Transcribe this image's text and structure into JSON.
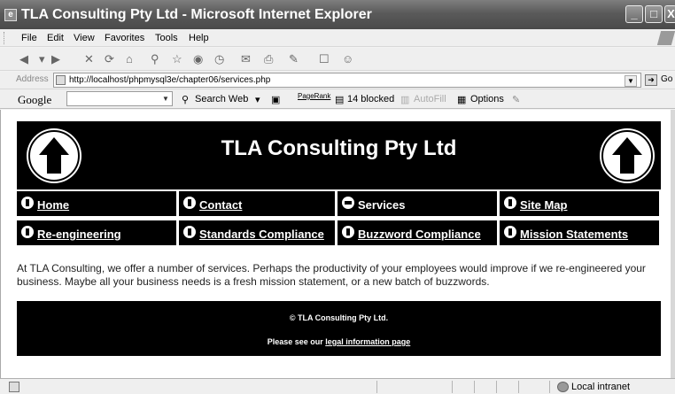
{
  "window": {
    "title": "TLA Consulting Pty Ltd - Microsoft Internet Explorer",
    "app_icon": "ie-page-icon",
    "min_symbol": "_",
    "max_symbol": "□",
    "close_symbol": "X"
  },
  "menu": [
    "File",
    "Edit",
    "View",
    "Favorites",
    "Tools",
    "Help"
  ],
  "toolbar": {
    "back": "◀",
    "forward": "▶",
    "stop": "✕",
    "refresh": "⟳",
    "home": "⌂",
    "search": "⚲",
    "favorites": "☆",
    "media": "◉",
    "history": "◷",
    "mail": "✉",
    "print": "⎙",
    "edit": "✎",
    "discuss": "☐",
    "messenger": "☺"
  },
  "address": {
    "label": "Address",
    "url": "http://localhost/phpmysql3e/chapter06/services.php",
    "go_label": "Go"
  },
  "google_toolbar": {
    "logo": "Google",
    "search_web": "Search Web",
    "pagerank": "PageRank",
    "blocked": "14 blocked",
    "autofill": "AutoFill",
    "options": "Options"
  },
  "page": {
    "heading": "TLA Consulting Pty Ltd",
    "nav": [
      {
        "label": "Home",
        "link": true
      },
      {
        "label": "Contact",
        "link": true
      },
      {
        "label": "Services",
        "link": false
      },
      {
        "label": "Site Map",
        "link": true
      },
      {
        "label": "Re-engineering",
        "link": true
      },
      {
        "label": "Standards Compliance",
        "link": true
      },
      {
        "label": "Buzzword Compliance",
        "link": true
      },
      {
        "label": "Mission Statements",
        "link": true
      }
    ],
    "body_text": "At TLA Consulting, we offer a number of services. Perhaps the productivity of your employees would improve if we re-engineered your business. Maybe all your business needs is a fresh mission statement, or a new batch of buzzwords.",
    "footer": {
      "copyright": "© TLA Consulting Pty Ltd.",
      "legal_prefix": "Please see our ",
      "legal_link": "legal information page"
    }
  },
  "status": {
    "zone": "Local intranet"
  }
}
